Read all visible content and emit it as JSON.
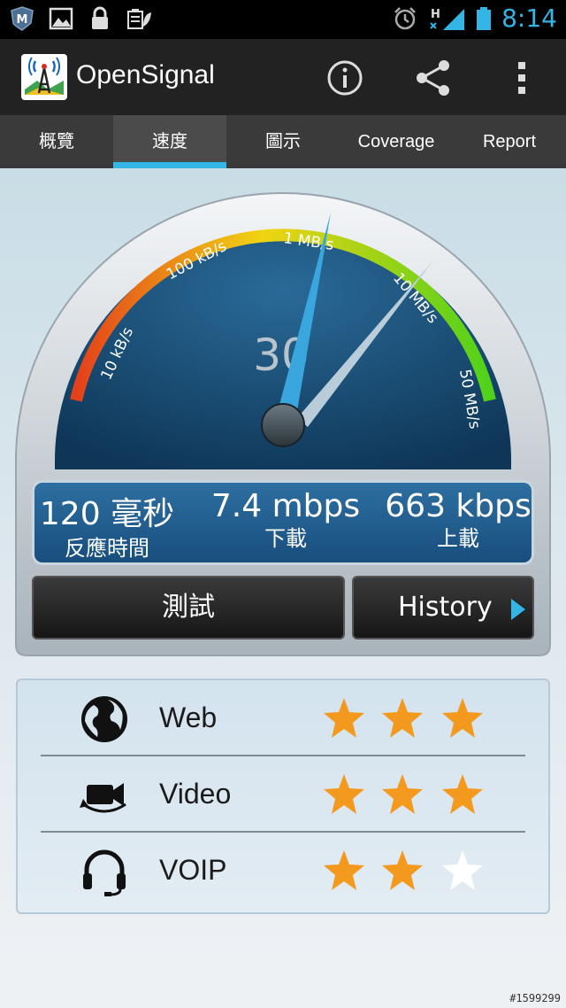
{
  "status_bar": {
    "time": "8:14",
    "network": "H",
    "icons": [
      "shield-icon",
      "picture-icon",
      "lock-icon",
      "battery-leaf-icon",
      "alarm-icon",
      "signal-icon",
      "battery-icon"
    ]
  },
  "app_bar": {
    "title": "OpenSignal",
    "actions": [
      "info-icon",
      "share-icon",
      "overflow-menu-icon"
    ]
  },
  "tabs": [
    {
      "label": "概覽",
      "active": false
    },
    {
      "label": "速度",
      "active": true
    },
    {
      "label": "圖示",
      "active": false
    },
    {
      "label": "Coverage",
      "active": false
    },
    {
      "label": "Report",
      "active": false
    }
  ],
  "gauge": {
    "scale_labels": [
      "10 kB/s",
      "100 kB/s",
      "1 MB/s",
      "10 MB/s",
      "50 MB/s"
    ],
    "center_value": "30",
    "colors": {
      "low": "#e4401a",
      "mid": "#f0d413",
      "high": "#4fd21a",
      "dial": "#13456c"
    }
  },
  "readout": {
    "latency": {
      "value": "120 毫秒",
      "label": "反應時間"
    },
    "download": {
      "value": "7.4 mbps",
      "label": "下載"
    },
    "upload": {
      "value": "663 kbps",
      "label": "上載"
    }
  },
  "buttons": {
    "test": "測試",
    "history": "History"
  },
  "quality": [
    {
      "label": "Web",
      "icon": "globe-icon",
      "stars": 3
    },
    {
      "label": "Video",
      "icon": "video-camera-icon",
      "stars": 3
    },
    {
      "label": "VOIP",
      "icon": "headset-icon",
      "stars": 2
    }
  ],
  "watermark": "#1599299",
  "colors": {
    "accent": "#33b5e5",
    "star_on": "#f39a1e",
    "star_off": "#ffffff"
  }
}
